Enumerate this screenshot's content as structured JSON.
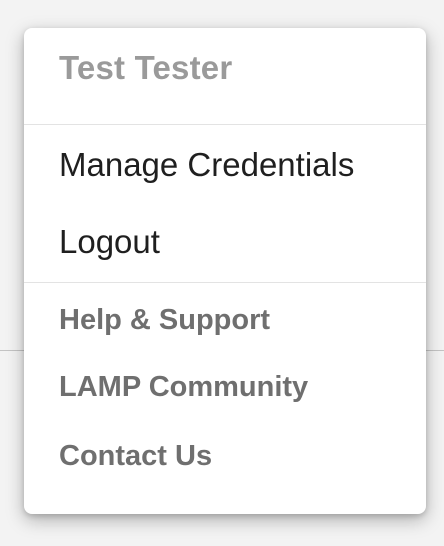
{
  "user": {
    "name": "Test Tester"
  },
  "primary_items": [
    {
      "label": "Manage Credentials"
    },
    {
      "label": "Logout"
    }
  ],
  "secondary_items": [
    {
      "label": "Help & Support"
    },
    {
      "label": "LAMP Community"
    },
    {
      "label": "Contact Us"
    }
  ],
  "colors": {
    "user_name": "#9a9a9a",
    "primary_text": "#1f1f1f",
    "secondary_text": "#6f6f6f",
    "divider": "#e3e3e3",
    "menu_background": "#ffffff"
  }
}
